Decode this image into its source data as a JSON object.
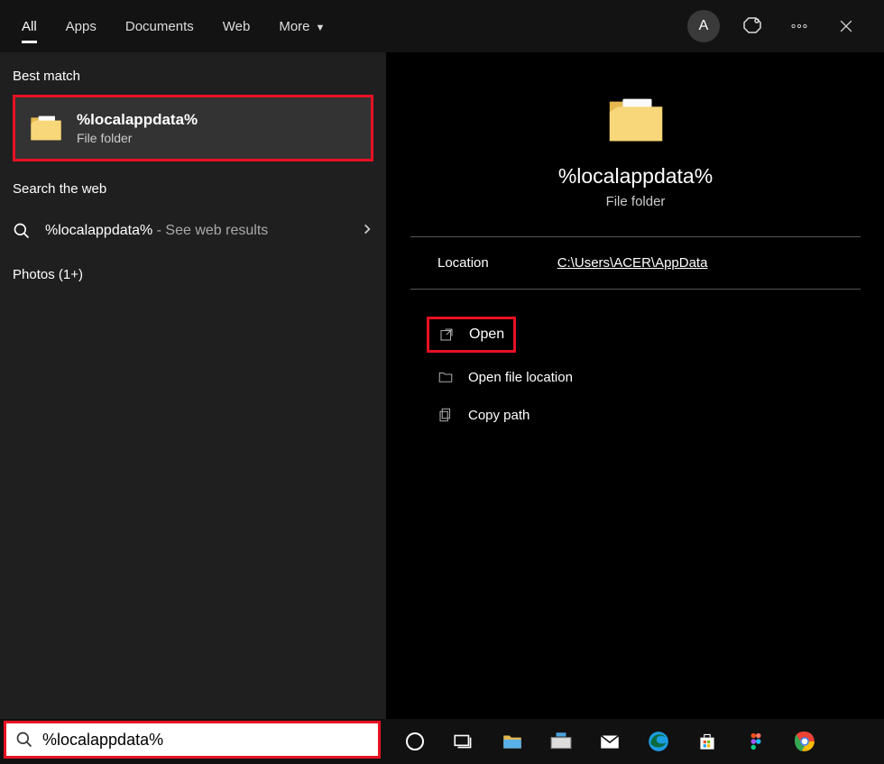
{
  "tabs": {
    "all": "All",
    "apps": "Apps",
    "documents": "Documents",
    "web": "Web",
    "more": "More"
  },
  "avatar_letter": "A",
  "left": {
    "best_match_label": "Best match",
    "result_title": "%localappdata%",
    "result_sub": "File folder",
    "search_web_label": "Search the web",
    "web_query": "%localappdata%",
    "web_suffix": " - See web results",
    "photos_label": "Photos (1+)"
  },
  "preview": {
    "title": "%localappdata%",
    "sub": "File folder",
    "location_label": "Location",
    "location_path": "C:\\Users\\ACER\\AppData",
    "actions": {
      "open": "Open",
      "open_loc": "Open file location",
      "copy_path": "Copy path"
    }
  },
  "search_value": "%localappdata%"
}
